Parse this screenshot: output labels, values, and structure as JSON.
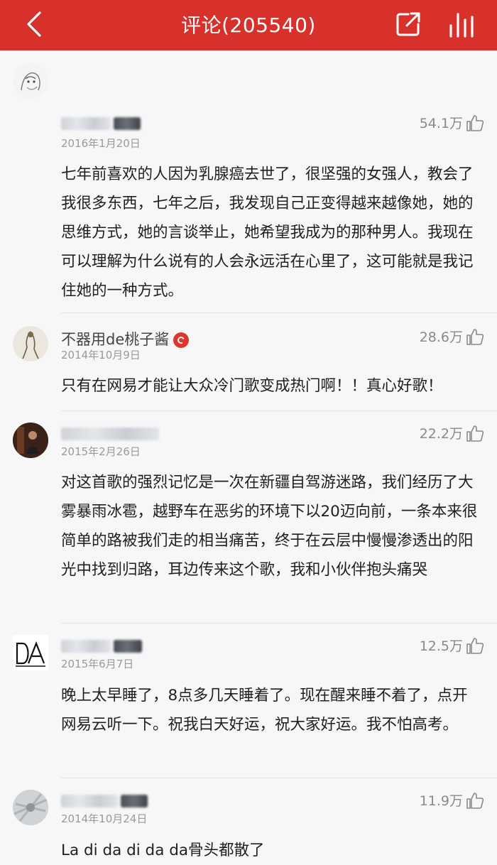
{
  "header": {
    "title": "评论(205540)"
  },
  "comments": [
    {
      "username": "",
      "date": "2016年1月20日",
      "likes": "54.1万",
      "text": "七年前喜欢的人因为乳腺癌去世了，很坚强的女强人，教会了我很多东西，七年之后，我发现自己正变得越来越像她，她的思维方式，她的言谈举止，她希望我成为的那种男人。我现在可以理解为什么说有的人会永远活在心里了，这可能就是我记住她的一种方式。"
    },
    {
      "username": "不器用de桃子酱",
      "date": "2014年10月9日",
      "likes": "28.6万",
      "text": "只有在网易才能让大众冷门歌变成热门啊！！真心好歌！"
    },
    {
      "username": "",
      "date": "2015年2月26日",
      "likes": "22.2万",
      "text": "对这首歌的强烈记忆是一次在新疆自驾游迷路，我们经历了大雾暴雨冰雹，越野车在恶劣的环境下以20迈向前，一条本来很简单的路被我们走的相当痛苦，终于在云层中慢慢渗透出的阳光中找到归路，耳边传来这个歌，我和小伙伴抱头痛哭"
    },
    {
      "username": "",
      "date": "2015年6月7日",
      "likes": "12.5万",
      "text": "晚上太早睡了，8点多几天睡着了。现在醒来睡不着了，点开网易云听一下。祝我白天好运，祝大家好运。我不怕高考。"
    },
    {
      "username": "",
      "date": "2014年10月24日",
      "likes": "11.9万",
      "text": "La di da di da da骨头都散了"
    }
  ],
  "icons": {
    "back": "chevron-left-icon",
    "share": "share-icon",
    "chart": "chart-bars-icon",
    "like": "thumbs-up-icon",
    "badge": "music-badge-icon"
  },
  "colors": {
    "header_bg": "#d8312c",
    "badge": "#e0352d"
  }
}
